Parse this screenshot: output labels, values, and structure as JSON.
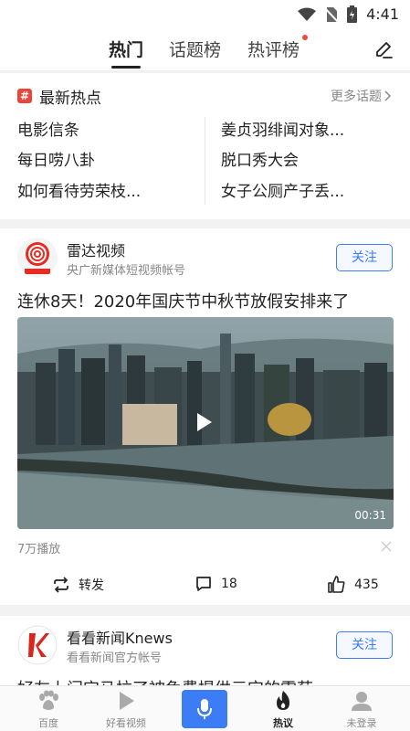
{
  "status_bar": {
    "time": "4:41"
  },
  "top_tabs": [
    {
      "label": "热门",
      "active": true
    },
    {
      "label": "话题榜",
      "active": false
    },
    {
      "label": "热评榜",
      "active": false,
      "has_dot": true
    }
  ],
  "hot_topics": {
    "badge": "#",
    "title": "最新热点",
    "more_label": "更多话题",
    "left": [
      "电影信条",
      "每日唠八卦",
      "如何看待劳荣枝..."
    ],
    "right": [
      "姜贞羽绯闻对象...",
      "脱口秀大会",
      "女子公厕产子丢..."
    ]
  },
  "posts": [
    {
      "author": "雷达视频",
      "author_desc": "央广新媒体短视频帐号",
      "follow_label": "关注",
      "title": "连休8天！2020年国庆节中秋节放假安排来了",
      "video_duration": "00:31",
      "plays": "7万播放",
      "actions": {
        "share_label": "转发",
        "comments": "18",
        "likes": "435"
      }
    },
    {
      "author": "看看新闻Knews",
      "author_desc": "看看新闻官方帐号",
      "follow_label": "关注",
      "title": "好友上门宝马拉了被免费提供元宝的雪茄"
    }
  ],
  "bottom_nav": [
    {
      "label": "百度",
      "icon": "baidu-paw-icon"
    },
    {
      "label": "好看视频",
      "icon": "play-icon"
    },
    {
      "label": "",
      "icon": "microphone-icon"
    },
    {
      "label": "热议",
      "icon": "flame-icon",
      "active": true
    },
    {
      "label": "未登录",
      "icon": "user-icon"
    }
  ],
  "colors": {
    "accent": "#3c7cf4",
    "hot_red": "#e9453a",
    "text": "#222222",
    "muted": "#888888"
  }
}
